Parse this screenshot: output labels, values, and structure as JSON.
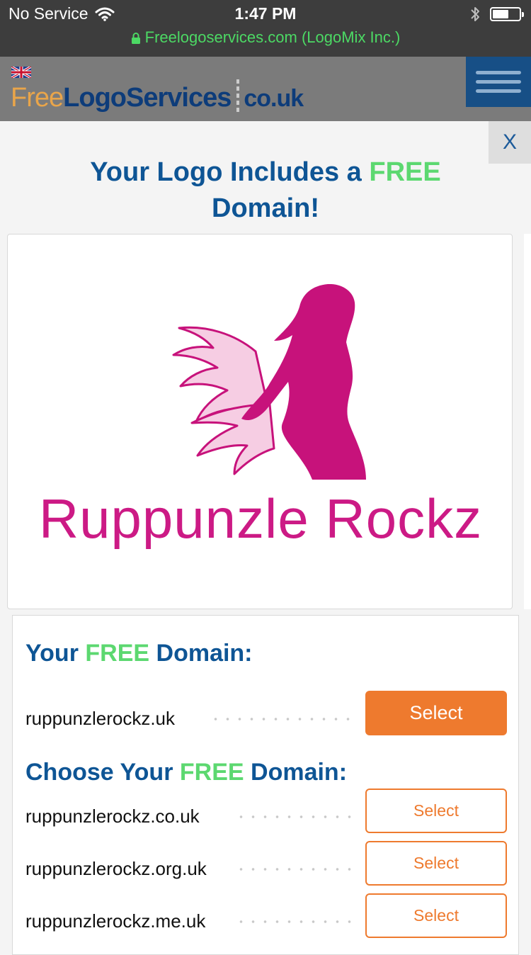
{
  "status_bar": {
    "carrier": "No Service",
    "time": "1:47 PM",
    "url": "Freelogoservices.com (LogoMix Inc.)",
    "battery_level": 0.6
  },
  "header": {
    "brand_free": "Free",
    "brand_logoservices": "LogoServices",
    "brand_tld": "co.uk"
  },
  "close_label": "X",
  "headline": {
    "part1": "Your Logo Includes a ",
    "highlight": "FREE",
    "part2": "Domain!"
  },
  "logo": {
    "brand_name": "Ruppunzle Rockz"
  },
  "free_domain": {
    "title_part1": "Your ",
    "title_highlight": "FREE",
    "title_part2": " Domain:",
    "domain": "ruppunzlerockz.uk",
    "button_label": "Select"
  },
  "choose_domain": {
    "title_part1": "Choose Your ",
    "title_highlight": "FREE",
    "title_part2": " Domain:",
    "options": [
      {
        "domain": "ruppunzlerockz.co.uk",
        "button_label": "Select"
      },
      {
        "domain": "ruppunzlerockz.org.uk",
        "button_label": "Select"
      },
      {
        "domain": "ruppunzlerockz.me.uk",
        "button_label": "Select"
      }
    ]
  },
  "colors": {
    "status_bar_bg": "#3d3d3d",
    "url_green": "#4cd964",
    "header_bg": "#7b7b7b",
    "menu_bg": "#174f86",
    "title_blue": "#0e5595",
    "free_green": "#5cd870",
    "logo_magenta": "#cc1a85",
    "logo_pink": "#f6cde3",
    "accent_orange": "#ee7a2e"
  }
}
